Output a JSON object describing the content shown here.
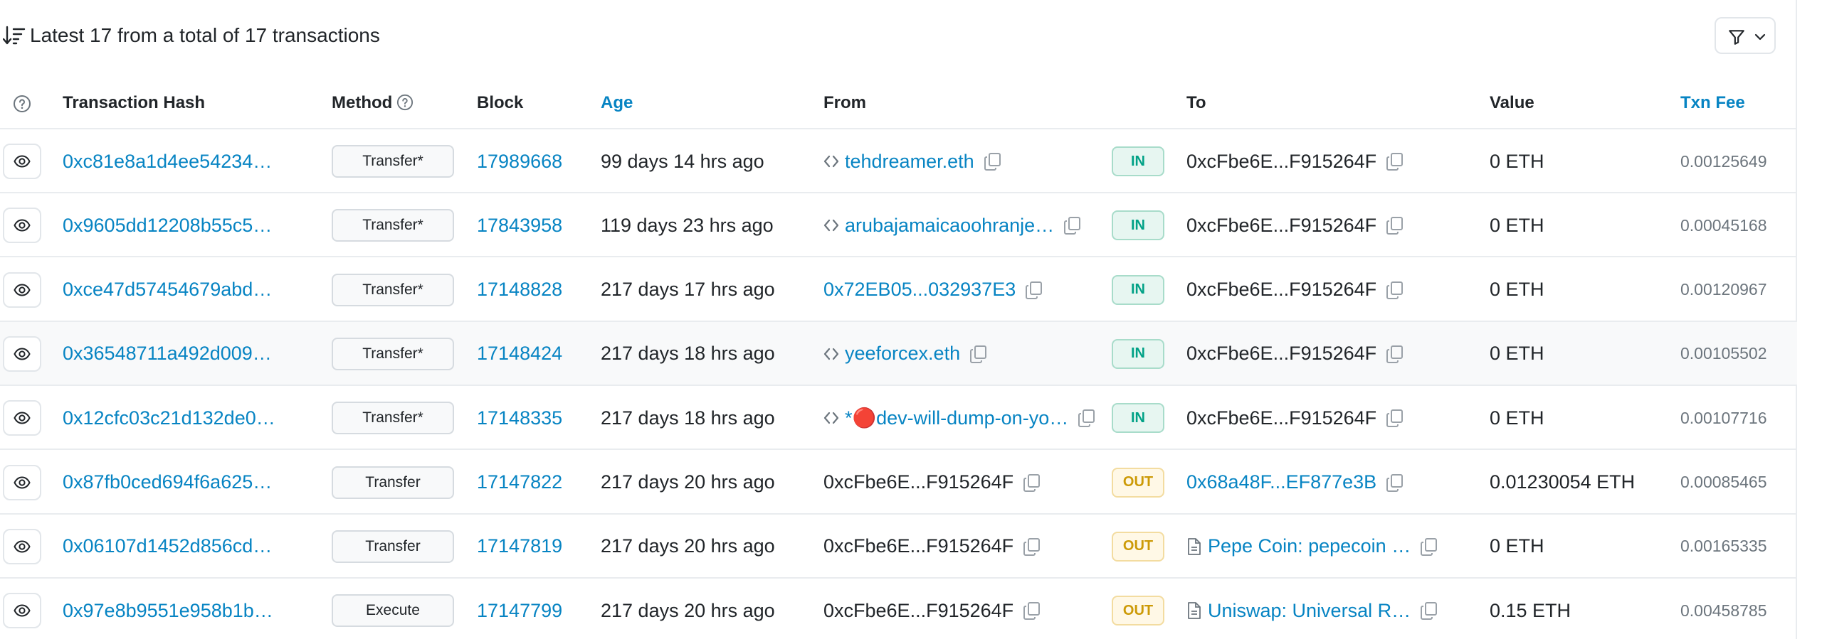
{
  "summary": "Latest 17 from a total of 17 transactions",
  "columns": {
    "hash": "Transaction Hash",
    "method": "Method",
    "block": "Block",
    "age": "Age",
    "from": "From",
    "to": "To",
    "value": "Value",
    "fee": "Txn Fee"
  },
  "colors": {
    "link": "#0784c3",
    "in": "#00a186",
    "out": "#cc9a06"
  },
  "rows": [
    {
      "hash": "0xc81e8a1d4ee54234…",
      "method": "Transfer*",
      "block": "17989668",
      "age": "99 days 14 hrs ago",
      "from": "tehdreamer.eth",
      "from_icon": "contract-icon",
      "direction": "IN",
      "to": "0xcFbe6E...F915264F",
      "value": "0 ETH",
      "fee": "0.00125649"
    },
    {
      "hash": "0x9605dd12208b55c5…",
      "method": "Transfer*",
      "block": "17843958",
      "age": "119 days 23 hrs ago",
      "from": "arubajamaicaoohranje…",
      "from_icon": "contract-icon",
      "direction": "IN",
      "to": "0xcFbe6E...F915264F",
      "value": "0 ETH",
      "fee": "0.00045168"
    },
    {
      "hash": "0xce47d57454679abd…",
      "method": "Transfer*",
      "block": "17148828",
      "age": "217 days 17 hrs ago",
      "from": "0x72EB05...032937E3",
      "from_icon": "",
      "direction": "IN",
      "to": "0xcFbe6E...F915264F",
      "value": "0 ETH",
      "fee": "0.00120967"
    },
    {
      "hash": "0x36548711a492d009…",
      "method": "Transfer*",
      "block": "17148424",
      "age": "217 days 18 hrs ago",
      "from": "yeeforcex.eth",
      "from_icon": "contract-icon",
      "direction": "IN",
      "to": "0xcFbe6E...F915264F",
      "value": "0 ETH",
      "fee": "0.00105502"
    },
    {
      "hash": "0x12cfc03c21d132de0…",
      "method": "Transfer*",
      "block": "17148335",
      "age": "217 days 18 hrs ago",
      "from": "*🔴dev-will-dump-on-yo…",
      "from_icon": "contract-icon",
      "direction": "IN",
      "to": "0xcFbe6E...F915264F",
      "value": "0 ETH",
      "fee": "0.00107716"
    },
    {
      "hash": "0x87fb0ced694f6a625…",
      "method": "Transfer",
      "block": "17147822",
      "age": "217 days 20 hrs ago",
      "from": "0xcFbe6E...F915264F",
      "from_icon": "",
      "direction": "OUT",
      "to": "0x68a48F...EF877e3B",
      "value": "0.01230054 ETH",
      "fee": "0.00085465"
    },
    {
      "hash": "0x06107d1452d856cd…",
      "method": "Transfer",
      "block": "17147819",
      "age": "217 days 20 hrs ago",
      "from": "0xcFbe6E...F915264F",
      "from_icon": "",
      "direction": "OUT",
      "to": "Pepe Coin: pepecoin …",
      "value": "0 ETH",
      "fee": "0.00165335"
    },
    {
      "hash": "0x97e8b9551e958b1b…",
      "method": "Execute",
      "block": "17147799",
      "age": "217 days 20 hrs ago",
      "from": "0xcFbe6E...F915264F",
      "from_icon": "",
      "direction": "OUT",
      "to": "Uniswap: Universal R…",
      "value": "0.15 ETH",
      "fee": "0.00458785"
    }
  ]
}
